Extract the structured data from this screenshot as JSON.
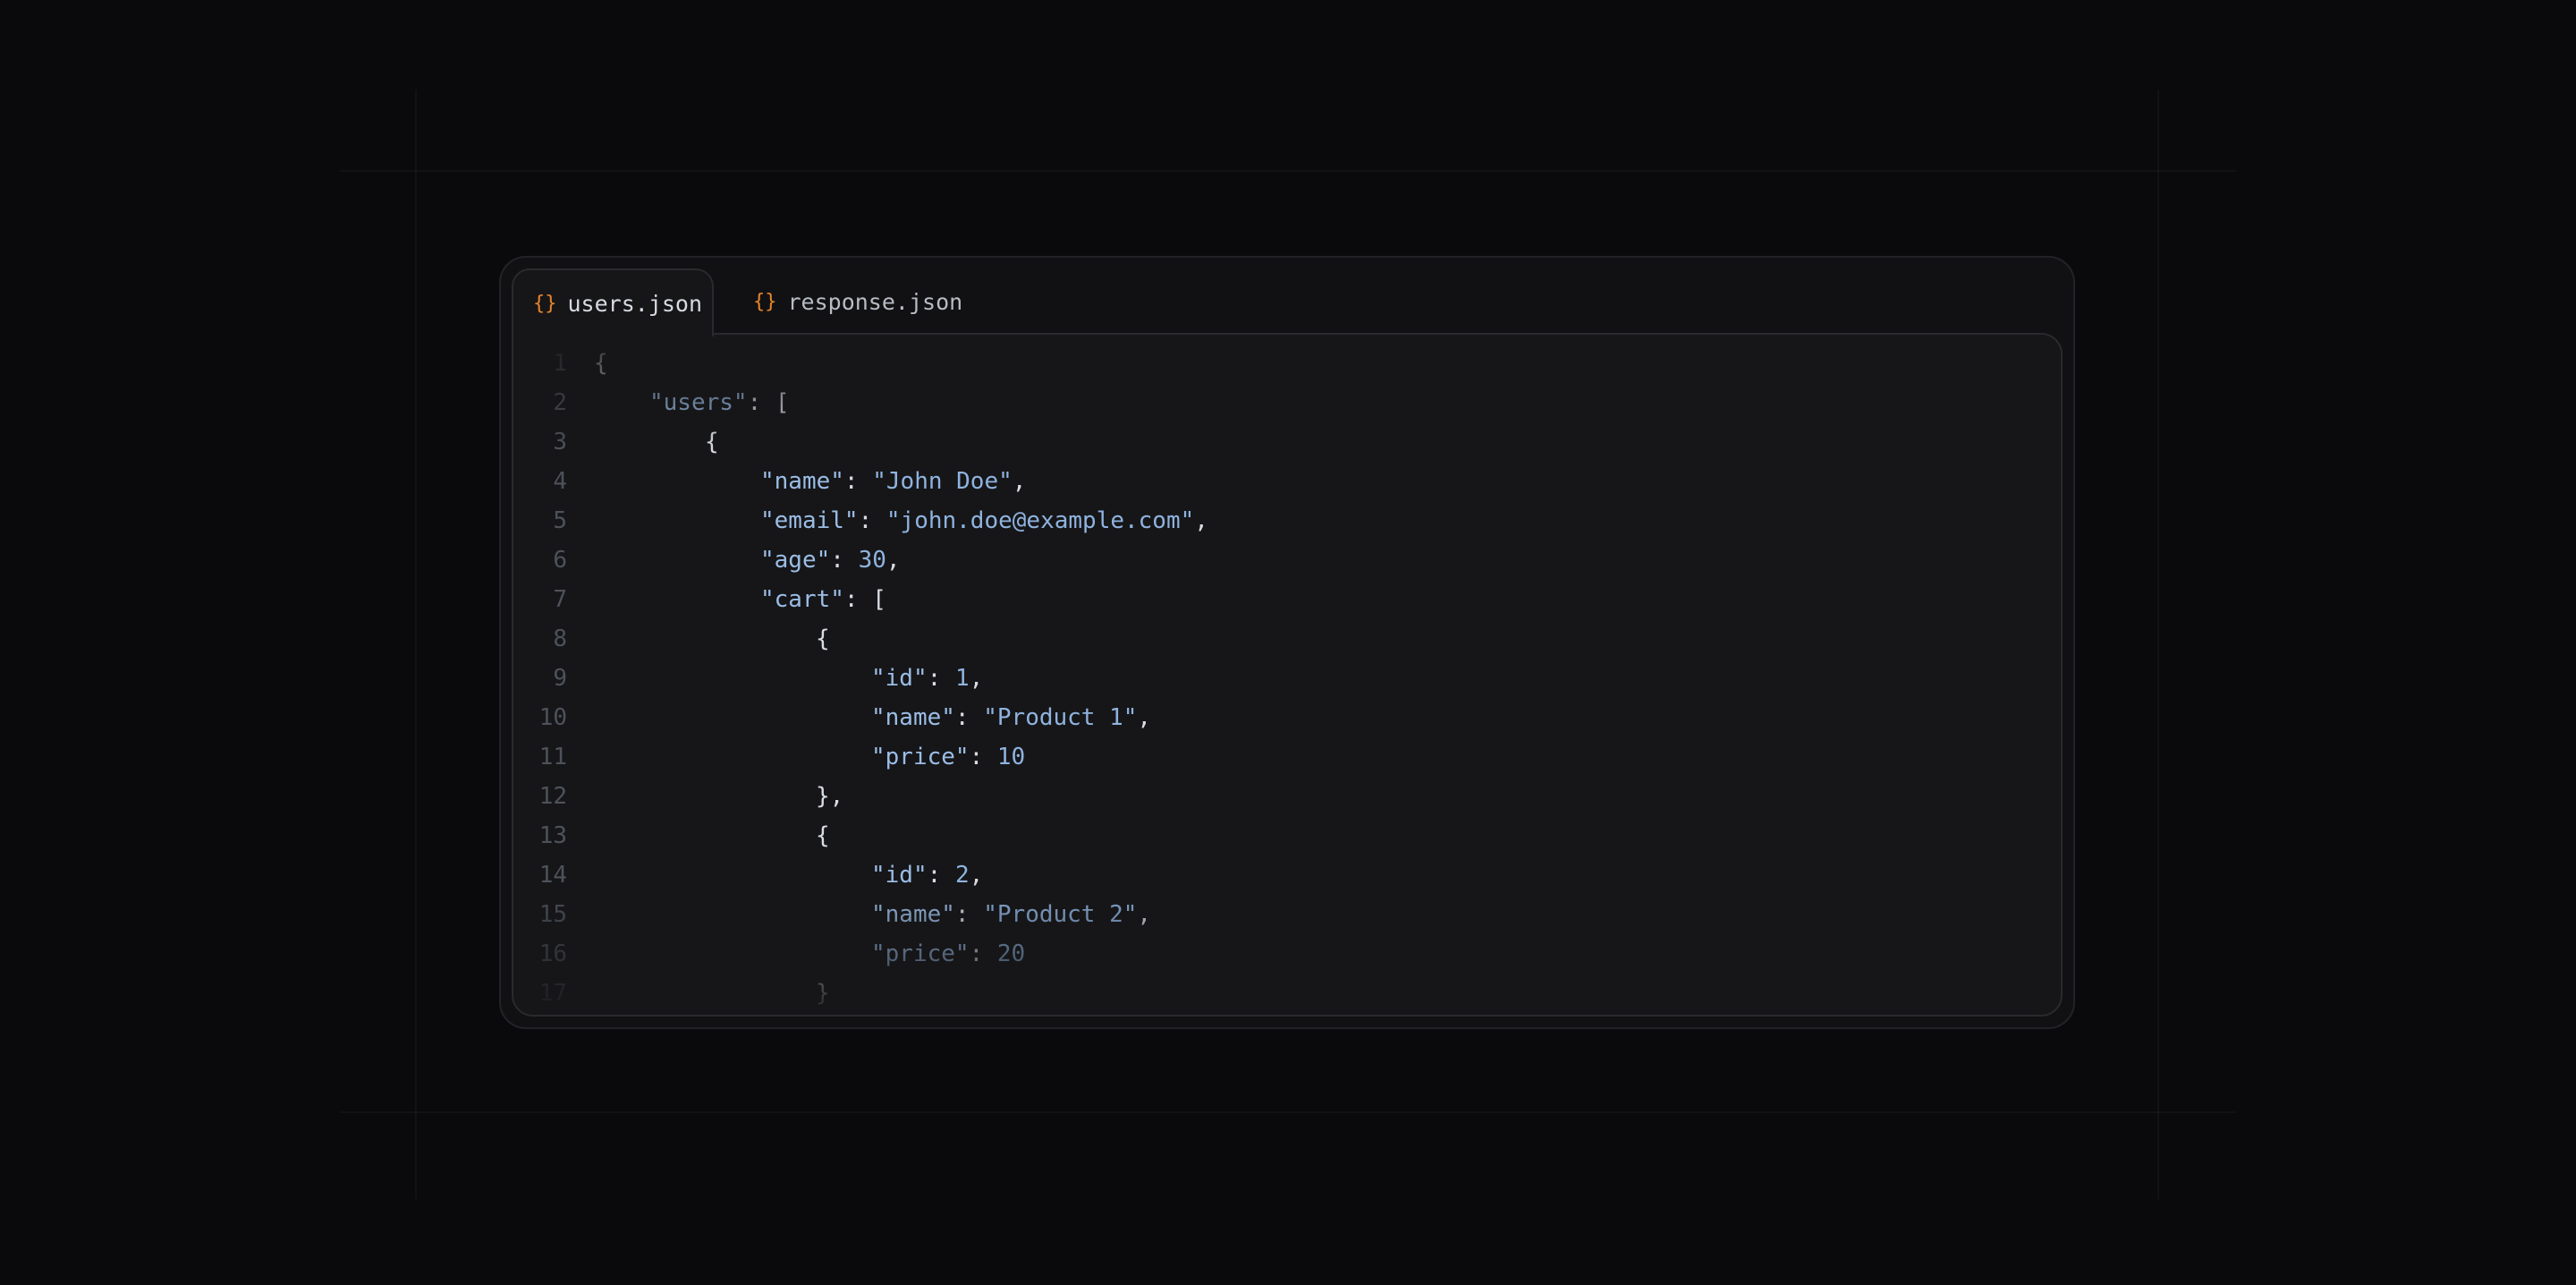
{
  "tabs": [
    {
      "icon": "braces-icon",
      "glyph": "{}",
      "label": "users.json",
      "active": true
    },
    {
      "icon": "braces-icon",
      "glyph": "{}",
      "label": "response.json",
      "active": false
    }
  ],
  "code": {
    "language": "json",
    "lines": [
      {
        "n": "1",
        "indent": 0,
        "tokens": [
          [
            "p",
            "{"
          ]
        ]
      },
      {
        "n": "2",
        "indent": 1,
        "tokens": [
          [
            "k",
            "\"users\""
          ],
          [
            "p",
            ": ["
          ]
        ]
      },
      {
        "n": "3",
        "indent": 2,
        "tokens": [
          [
            "p",
            "{"
          ]
        ]
      },
      {
        "n": "4",
        "indent": 3,
        "tokens": [
          [
            "k",
            "\"name\""
          ],
          [
            "p",
            ": "
          ],
          [
            "s",
            "\"John Doe\""
          ],
          [
            "p",
            ","
          ]
        ]
      },
      {
        "n": "5",
        "indent": 3,
        "tokens": [
          [
            "k",
            "\"email\""
          ],
          [
            "p",
            ": "
          ],
          [
            "s",
            "\"john.doe@example.com\""
          ],
          [
            "p",
            ","
          ]
        ]
      },
      {
        "n": "6",
        "indent": 3,
        "tokens": [
          [
            "k",
            "\"age\""
          ],
          [
            "p",
            ": "
          ],
          [
            "n",
            "30"
          ],
          [
            "p",
            ","
          ]
        ]
      },
      {
        "n": "7",
        "indent": 3,
        "tokens": [
          [
            "k",
            "\"cart\""
          ],
          [
            "p",
            ": ["
          ]
        ]
      },
      {
        "n": "8",
        "indent": 4,
        "tokens": [
          [
            "p",
            "{"
          ]
        ]
      },
      {
        "n": "9",
        "indent": 5,
        "tokens": [
          [
            "k",
            "\"id\""
          ],
          [
            "p",
            ": "
          ],
          [
            "n",
            "1"
          ],
          [
            "p",
            ","
          ]
        ]
      },
      {
        "n": "10",
        "indent": 5,
        "tokens": [
          [
            "k",
            "\"name\""
          ],
          [
            "p",
            ": "
          ],
          [
            "s",
            "\"Product 1\""
          ],
          [
            "p",
            ","
          ]
        ]
      },
      {
        "n": "11",
        "indent": 5,
        "tokens": [
          [
            "k",
            "\"price\""
          ],
          [
            "p",
            ": "
          ],
          [
            "n",
            "10"
          ]
        ]
      },
      {
        "n": "12",
        "indent": 4,
        "tokens": [
          [
            "p",
            "},"
          ]
        ]
      },
      {
        "n": "13",
        "indent": 4,
        "tokens": [
          [
            "p",
            "{"
          ]
        ]
      },
      {
        "n": "14",
        "indent": 5,
        "tokens": [
          [
            "k",
            "\"id\""
          ],
          [
            "p",
            ": "
          ],
          [
            "n",
            "2"
          ],
          [
            "p",
            ","
          ]
        ]
      },
      {
        "n": "15",
        "indent": 5,
        "tokens": [
          [
            "k",
            "\"name\""
          ],
          [
            "p",
            ": "
          ],
          [
            "s",
            "\"Product 2\""
          ],
          [
            "p",
            ","
          ]
        ]
      },
      {
        "n": "16",
        "indent": 5,
        "tokens": [
          [
            "k",
            "\"price\""
          ],
          [
            "p",
            ": "
          ],
          [
            "n",
            "20"
          ]
        ]
      },
      {
        "n": "17",
        "indent": 4,
        "tokens": [
          [
            "p",
            "}"
          ]
        ]
      }
    ]
  },
  "colors": {
    "background": "#0a0a0c",
    "window": "#111113",
    "editor": "#161618",
    "brace_icon": "#e7842b",
    "key": "#9bbde6",
    "string": "#8fb3df",
    "punctuation": "#d9dde3",
    "line_number": "#4d525a"
  }
}
